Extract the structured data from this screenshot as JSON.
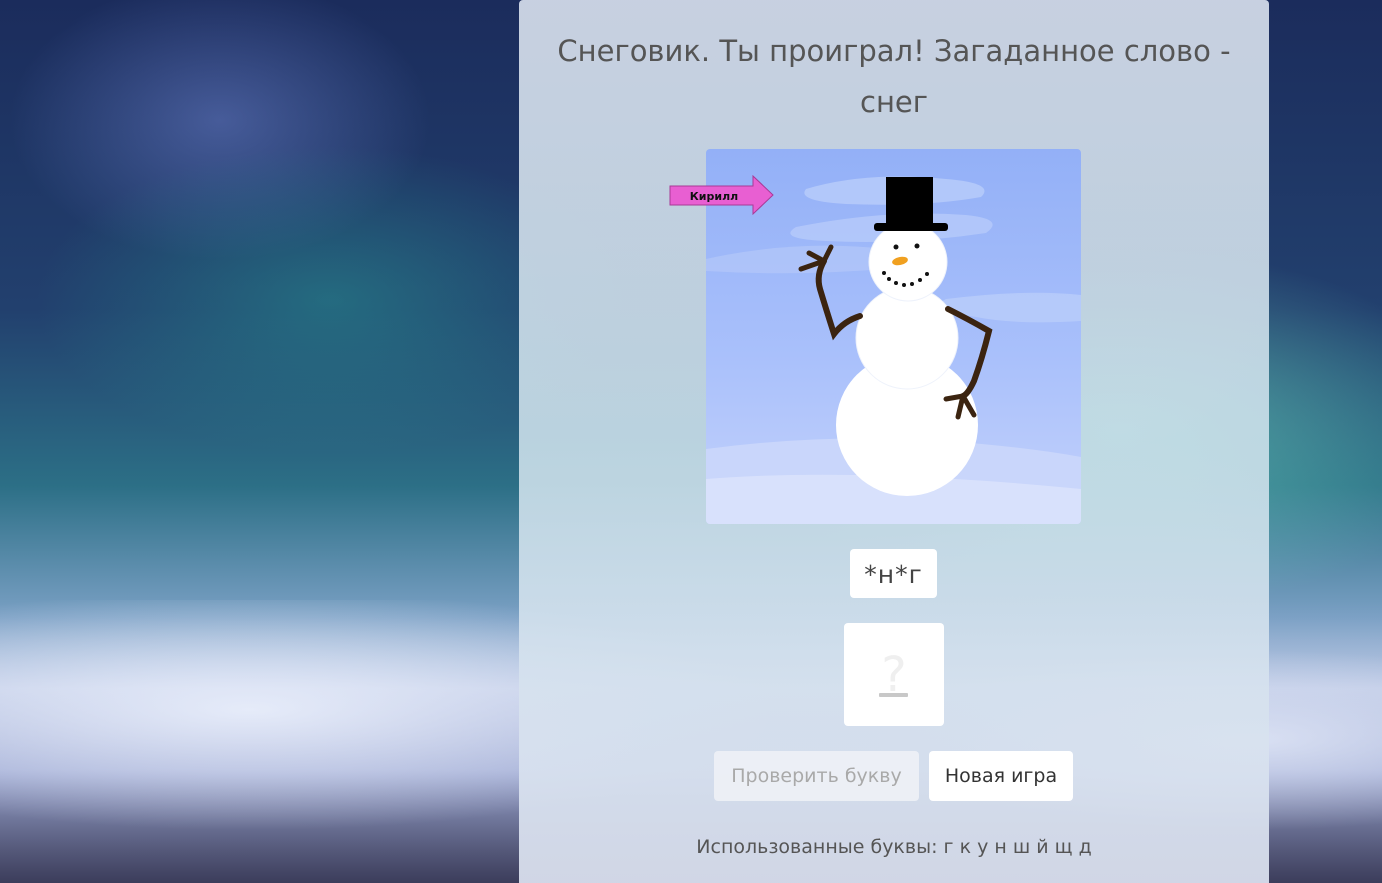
{
  "game": {
    "title": "Снеговик. Ты проиграл! Загаданное слово - снег",
    "name_tag": "Кирилл",
    "masked_word": "*н*г",
    "input_placeholder": "?",
    "check_button_label": "Проверить букву",
    "new_game_button_label": "Новая игра",
    "used_letters_text": "Использованные буквы: г к у н ш й щ д"
  },
  "colors": {
    "panel_text": "#555555",
    "name_tag_fill": "#e85fd2",
    "sky": "#9ab4f8",
    "hat": "#000000",
    "arms": "#3b2410",
    "nose": "#f0a020"
  }
}
